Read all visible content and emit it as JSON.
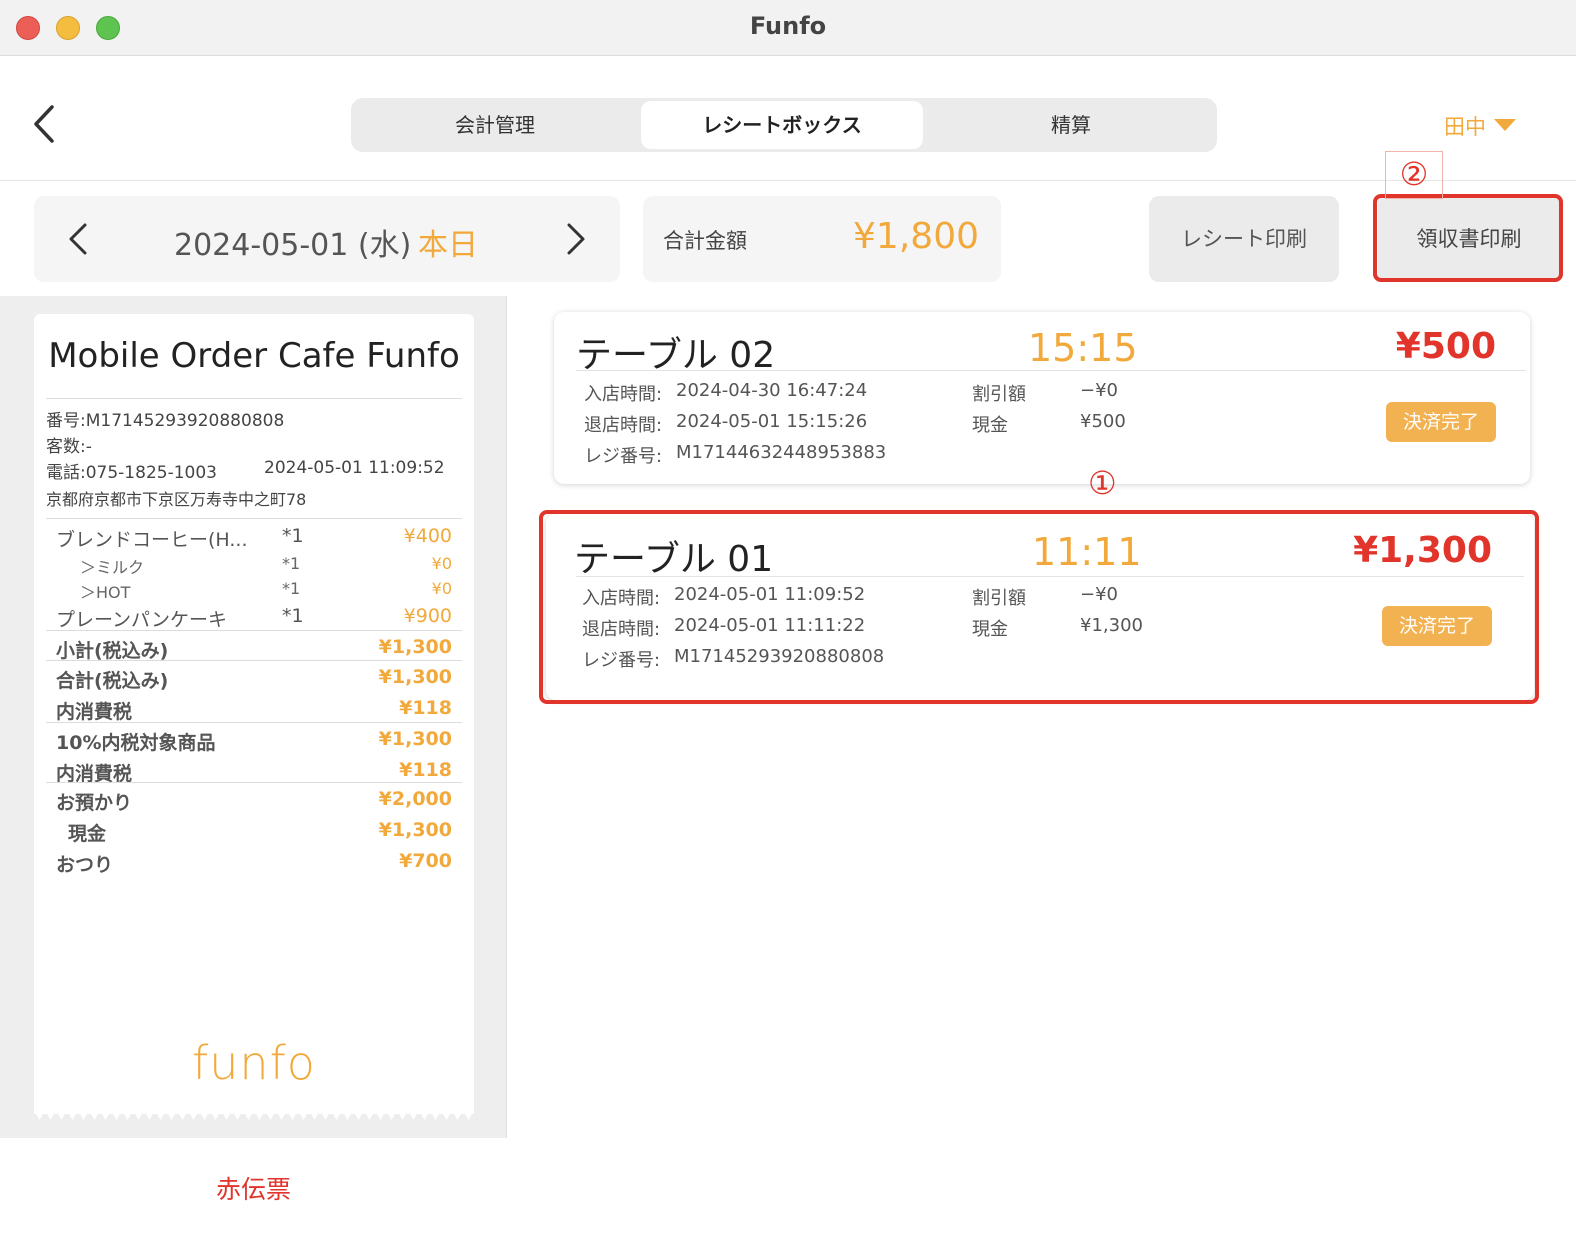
{
  "window": {
    "title": "Funfo"
  },
  "header": {
    "tabs": [
      {
        "label": "会計管理",
        "active": false
      },
      {
        "label": "レシートボックス",
        "active": true
      },
      {
        "label": "精算",
        "active": false
      }
    ],
    "user": "田中"
  },
  "toolbar": {
    "date": "2024-05-01 (水)",
    "today": "本日",
    "total_label": "合計金額",
    "total_value": "¥1,800",
    "receipt_print": "レシート印刷",
    "ryoshu_print": "領収書印刷"
  },
  "annotations": {
    "marker1": "①",
    "marker2": "②",
    "highlight_color": "#e1342b"
  },
  "receipt": {
    "store_name": "Mobile Order Cafe Funfo",
    "number": "番号:M17145293920880808",
    "guests": "客数:-",
    "phone": "電話:075-1825-1003",
    "datetime": "2024-05-01 11:09:52",
    "address": "京都府京都市下京区万寿寺中之町78",
    "items": [
      {
        "name": "ブレンドコーヒー(H...",
        "qty": "*1",
        "amount": "¥400"
      },
      {
        "name": "＞ミルク",
        "qty": "*1",
        "amount": "¥0"
      },
      {
        "name": "＞HOT",
        "qty": "*1",
        "amount": "¥0"
      },
      {
        "name": "プレーンパンケーキ",
        "qty": "*1",
        "amount": "¥900"
      }
    ],
    "totals": [
      {
        "label": "小計(税込み)",
        "amount": "¥1,300"
      },
      {
        "label": "合計(税込み)",
        "amount": "¥1,300"
      },
      {
        "label": "内消費税",
        "amount": "¥118"
      },
      {
        "label": "10%内税対象商品",
        "amount": "¥1,300"
      },
      {
        "label": "内消費税",
        "amount": "¥118"
      },
      {
        "label": "お預かり",
        "amount": "¥2,000"
      },
      {
        "label": "現金",
        "amount": "¥1,300"
      },
      {
        "label": "おつり",
        "amount": "¥700"
      }
    ],
    "logo": "funfo",
    "red_slip": "赤伝票"
  },
  "orders": [
    {
      "table": "テーブル 02",
      "time": "15:15",
      "amount": "¥500",
      "in_label": "入店時間:",
      "in_time": "2024-04-30 16:47:24",
      "out_label": "退店時間:",
      "out_time": "2024-05-01 15:15:26",
      "reg_label": "レジ番号:",
      "reg_no": "M17144632448953883",
      "discount_label": "割引額",
      "discount": "−¥0",
      "cash_label": "現金",
      "cash": "¥500",
      "status": "決済完了"
    },
    {
      "table": "テーブル 01",
      "time": "11:11",
      "amount": "¥1,300",
      "in_label": "入店時間:",
      "in_time": "2024-05-01 11:09:52",
      "out_label": "退店時間:",
      "out_time": "2024-05-01 11:11:22",
      "reg_label": "レジ番号:",
      "reg_no": "M17145293920880808",
      "discount_label": "割引額",
      "discount": "−¥0",
      "cash_label": "現金",
      "cash": "¥1,300",
      "status": "決済完了"
    }
  ],
  "colors": {
    "accent": "#f2a93b",
    "danger": "#e1342b",
    "badge": "#f2b251"
  },
  "icons": [
    "back-chevron-icon",
    "caret-down-icon",
    "chevron-left-icon",
    "chevron-right-icon"
  ]
}
